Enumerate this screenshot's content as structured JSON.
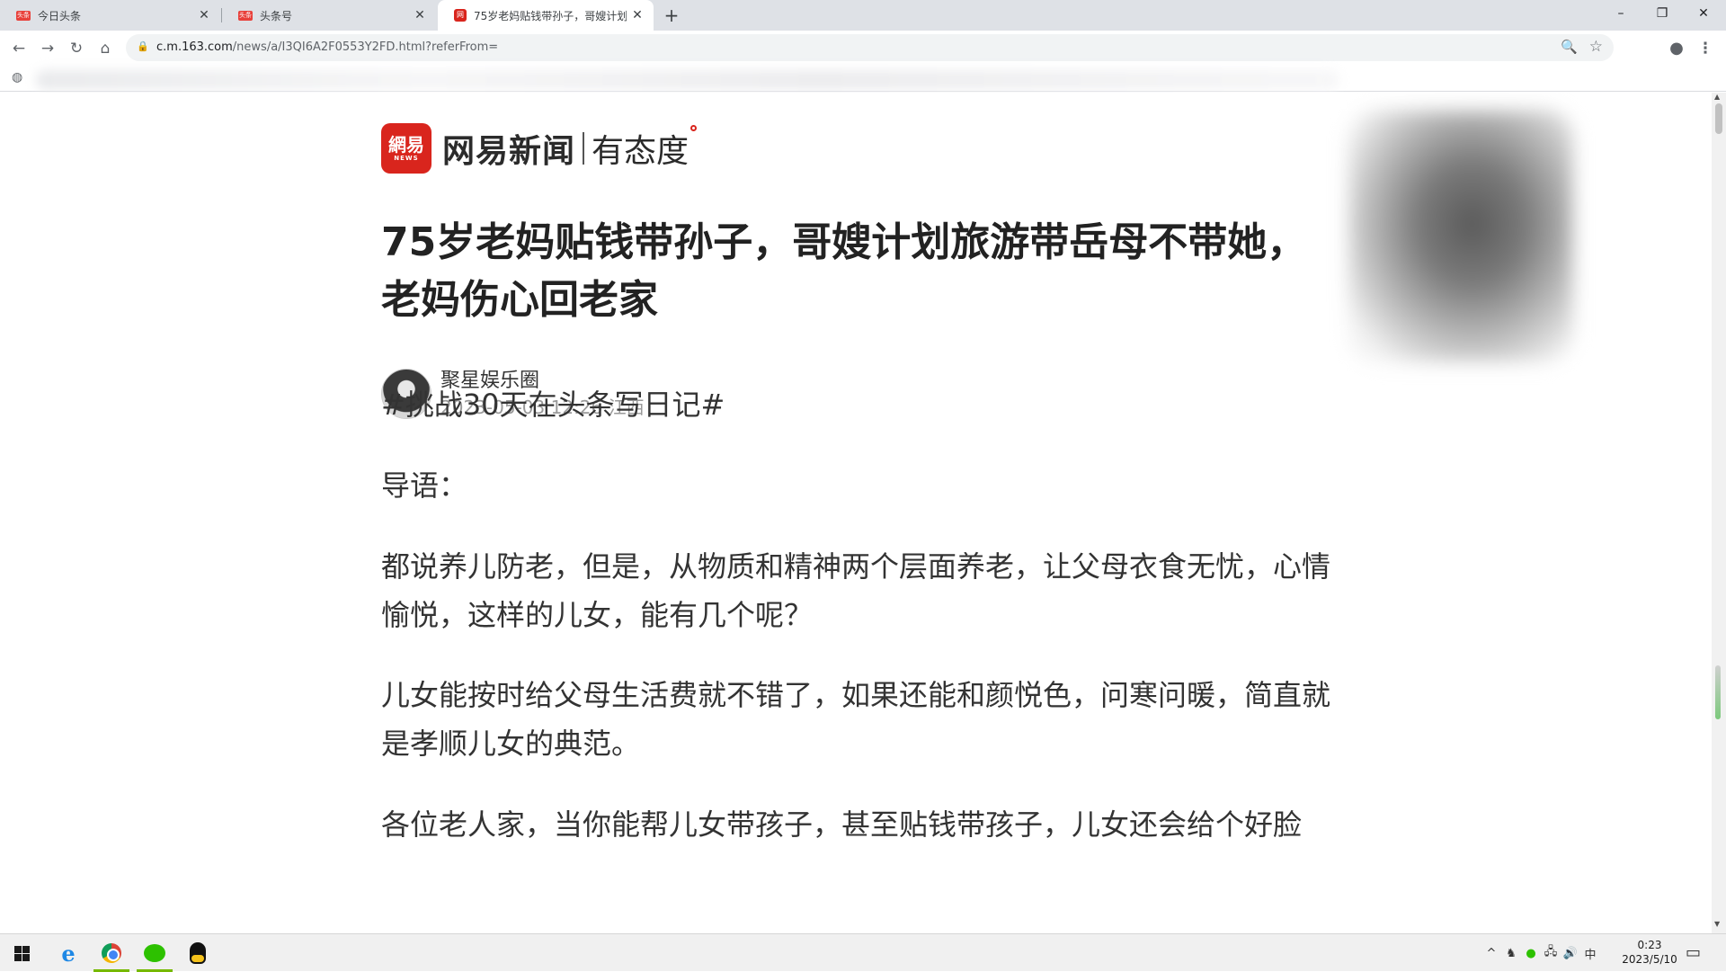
{
  "browser": {
    "tabs": [
      {
        "title": "今日头条",
        "favicon": "头条"
      },
      {
        "title": "头条号",
        "favicon": "头条"
      },
      {
        "title": "75岁老妈贴钱带孙子，哥嫂计划",
        "favicon": "网易",
        "active": true
      }
    ],
    "new_tab_symbol": "+",
    "window_controls": {
      "minimize": "–",
      "restore": "❐",
      "close": "✕"
    },
    "nav": {
      "back": "←",
      "forward": "→",
      "reload": "↻",
      "home": "⌂"
    },
    "url": {
      "host": "c.m.163.com",
      "path": "/news/a/I3QI6A2F0553Y2FD.html?referFrom="
    },
    "omnibox_icons": {
      "zoom": "🔍",
      "star": "☆",
      "profile": "●",
      "menu": "⋮"
    }
  },
  "article": {
    "brand": {
      "badge_main": "網易",
      "badge_sub": "NEWS",
      "name": "网易新闻",
      "slogan": "有态度"
    },
    "title": "75岁老妈贴钱带孙子，哥嫂计划旅游带岳母不带她，老妈伤心回老家",
    "author": {
      "name": "聚星娱乐圈",
      "time": "2023-05-03 12:26 江西"
    },
    "paragraphs": [
      "#挑战30天在头条写日记#",
      "导语：",
      "都说养儿防老，但是，从物质和精神两个层面养老，让父母衣食无忧，心情愉悦，这样的儿女，能有几个呢？",
      "儿女能按时给父母生活费就不错了，如果还能和颜悦色，问寒问暖，简直就是孝顺儿女的典范。",
      "各位老人家，当你能帮儿女带孩子，甚至贴钱带孩子，儿女还会给个好脸"
    ]
  },
  "taskbar": {
    "apps": [
      "start-icon",
      "ie-icon",
      "chrome-icon",
      "wechat-icon",
      "qq-icon"
    ],
    "tray_symbols": [
      "^",
      "♞",
      "●",
      "🖧",
      "🔊",
      "中"
    ],
    "clock_time": "0:23",
    "clock_date": "2023/5/10"
  }
}
